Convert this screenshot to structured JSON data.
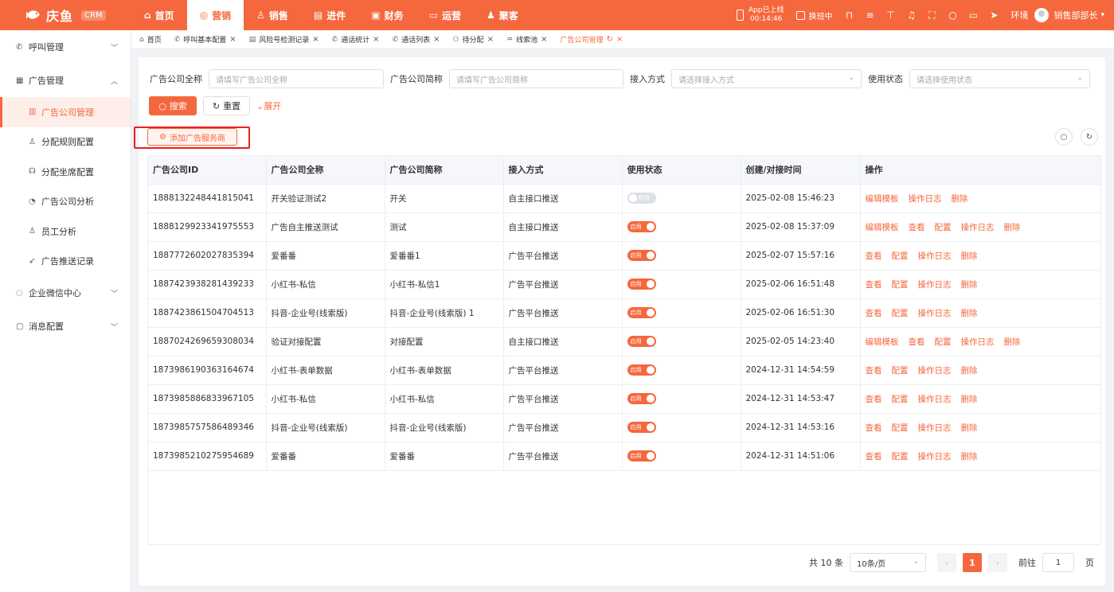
{
  "topbar": {
    "brand": "庆鱼",
    "crm_badge": "CRM",
    "nav": [
      {
        "label": "首页",
        "icon": "home-icon",
        "glyph": "⌂",
        "active": false
      },
      {
        "label": "营销",
        "icon": "target-icon",
        "glyph": "◎",
        "active": true
      },
      {
        "label": "销售",
        "icon": "user-icon",
        "glyph": "♙",
        "active": false
      },
      {
        "label": "进件",
        "icon": "document-icon",
        "glyph": "▤",
        "active": false
      },
      {
        "label": "财务",
        "icon": "wallet-icon",
        "glyph": "▣",
        "active": false
      },
      {
        "label": "运营",
        "icon": "monitor-icon",
        "glyph": "▭",
        "active": false
      },
      {
        "label": "聚客",
        "icon": "group-icon",
        "glyph": "♟",
        "active": false
      }
    ],
    "app_status_line1": "App已上线",
    "app_status_line2": "00:14:46",
    "shift_label": "换班中",
    "env_label": "环境",
    "user_name": "销售部部长"
  },
  "sidebar": {
    "groups": [
      {
        "label": "呼叫管理",
        "icon": "phone-icon",
        "glyph": "✆",
        "expanded": false,
        "children": []
      },
      {
        "label": "广告管理",
        "icon": "ad-icon",
        "glyph": "▦",
        "expanded": true,
        "children": [
          {
            "label": "广告公司管理",
            "icon": "building-icon",
            "glyph": "▥",
            "active": true
          },
          {
            "label": "分配规则配置",
            "icon": "user-rule-icon",
            "glyph": "♙",
            "active": false
          },
          {
            "label": "分配坐席配置",
            "icon": "headset-icon",
            "glyph": "☊",
            "active": false
          },
          {
            "label": "广告公司分析",
            "icon": "pie-chart-icon",
            "glyph": "◔",
            "active": false
          },
          {
            "label": "员工分析",
            "icon": "employee-icon",
            "glyph": "♙",
            "active": false
          },
          {
            "label": "广告推送记录",
            "icon": "push-icon",
            "glyph": "➶",
            "active": false
          }
        ]
      },
      {
        "label": "企业微信中心",
        "icon": "wechat-icon",
        "glyph": "◌",
        "expanded": false,
        "children": []
      },
      {
        "label": "消息配置",
        "icon": "message-icon",
        "glyph": "▢",
        "expanded": false,
        "children": []
      }
    ]
  },
  "tabs": [
    {
      "label": "首页",
      "icon": "home-icon",
      "glyph": "⌂",
      "closable": false,
      "active": false
    },
    {
      "label": "呼叫基本配置",
      "icon": "phone-icon",
      "glyph": "✆",
      "closable": true,
      "active": false
    },
    {
      "label": "风险号检测记录",
      "icon": "document-icon",
      "glyph": "▤",
      "closable": true,
      "active": false
    },
    {
      "label": "通话统计",
      "icon": "phone-icon",
      "glyph": "✆",
      "closable": true,
      "active": false
    },
    {
      "label": "通话列表",
      "icon": "phone-icon",
      "glyph": "✆",
      "closable": true,
      "active": false
    },
    {
      "label": "待分配",
      "icon": "share-icon",
      "glyph": "⚇",
      "closable": true,
      "active": false
    },
    {
      "label": "线索池",
      "icon": "pool-icon",
      "glyph": "♒",
      "closable": true,
      "active": false
    },
    {
      "label": "广告公司管理",
      "icon": "",
      "glyph": "",
      "closable": true,
      "active": true
    }
  ],
  "filters": {
    "full_name_label": "广告公司全称",
    "full_name_placeholder": "请填写广告公司全称",
    "short_name_label": "广告公司简称",
    "short_name_placeholder": "请填写广告公司简称",
    "access_label": "接入方式",
    "access_placeholder": "请选择接入方式",
    "status_label": "使用状态",
    "status_placeholder": "请选择使用状态"
  },
  "actions": {
    "search": "搜索",
    "reset": "重置",
    "expand": "展开",
    "add": "添加广告服务商"
  },
  "table": {
    "columns": [
      "广告公司ID",
      "广告公司全称",
      "广告公司简称",
      "接入方式",
      "使用状态",
      "创建/对接时间",
      "操作"
    ],
    "rows": [
      {
        "id": "1888132248441815041",
        "full": "开关验证测试2",
        "short": "开关",
        "access": "自主接口推送",
        "status": "禁用",
        "on": false,
        "time": "2025-02-08 15:46:23",
        "ops": [
          "编辑模板",
          "操作日志",
          "删除"
        ]
      },
      {
        "id": "1888129923341975553",
        "full": "广告自主推送测试",
        "short": "测试",
        "access": "自主接口推送",
        "status": "启用",
        "on": true,
        "time": "2025-02-08 15:37:09",
        "ops": [
          "编辑模板",
          "查看",
          "配置",
          "操作日志",
          "删除"
        ]
      },
      {
        "id": "1887772602027835394",
        "full": "爱番番",
        "short": "爱番番1",
        "access": "广告平台推送",
        "status": "启用",
        "on": true,
        "time": "2025-02-07 15:57:16",
        "ops": [
          "查看",
          "配置",
          "操作日志",
          "删除"
        ]
      },
      {
        "id": "1887423938281439233",
        "full": "小红书-私信",
        "short": "小红书-私信1",
        "access": "广告平台推送",
        "status": "启用",
        "on": true,
        "time": "2025-02-06 16:51:48",
        "ops": [
          "查看",
          "配置",
          "操作日志",
          "删除"
        ]
      },
      {
        "id": "1887423861504704513",
        "full": "抖音-企业号(线索版)",
        "short": "抖音-企业号(线索版) 1",
        "access": "广告平台推送",
        "status": "启用",
        "on": true,
        "time": "2025-02-06 16:51:30",
        "ops": [
          "查看",
          "配置",
          "操作日志",
          "删除"
        ]
      },
      {
        "id": "1887024269659308034",
        "full": "验证对接配置",
        "short": "对接配置",
        "access": "自主接口推送",
        "status": "启用",
        "on": true,
        "time": "2025-02-05 14:23:40",
        "ops": [
          "编辑模板",
          "查看",
          "配置",
          "操作日志",
          "删除"
        ]
      },
      {
        "id": "1873986190363164674",
        "full": "小红书-表单数据",
        "short": "小红书-表单数据",
        "access": "广告平台推送",
        "status": "启用",
        "on": true,
        "time": "2024-12-31 14:54:59",
        "ops": [
          "查看",
          "配置",
          "操作日志",
          "删除"
        ]
      },
      {
        "id": "1873985886833967105",
        "full": "小红书-私信",
        "short": "小红书-私信",
        "access": "广告平台推送",
        "status": "启用",
        "on": true,
        "time": "2024-12-31 14:53:47",
        "ops": [
          "查看",
          "配置",
          "操作日志",
          "删除"
        ]
      },
      {
        "id": "1873985757586489346",
        "full": "抖音-企业号(线索版)",
        "short": "抖音-企业号(线索版)",
        "access": "广告平台推送",
        "status": "启用",
        "on": true,
        "time": "2024-12-31 14:53:16",
        "ops": [
          "查看",
          "配置",
          "操作日志",
          "删除"
        ]
      },
      {
        "id": "1873985210275954689",
        "full": "爱番番",
        "short": "爱番番",
        "access": "广告平台推送",
        "status": "启用",
        "on": true,
        "time": "2024-12-31 14:51:06",
        "ops": [
          "查看",
          "配置",
          "操作日志",
          "删除"
        ]
      }
    ]
  },
  "pager": {
    "total": "共 10 条",
    "page_size": "10条/页",
    "current": "1",
    "goto_label": "前往",
    "goto_value": "1",
    "page_suffix": "页"
  },
  "colors": {
    "accent": "#f5683d",
    "highlight_box": "#e8201e"
  }
}
